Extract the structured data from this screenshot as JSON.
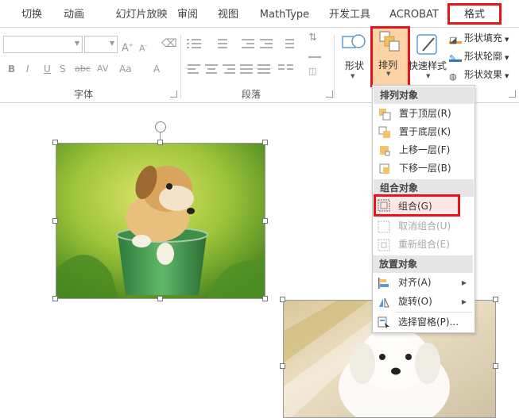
{
  "tabs": [
    {
      "label": "切换"
    },
    {
      "label": "动画"
    },
    {
      "label": "幻灯片放映"
    },
    {
      "label": "审阅"
    },
    {
      "label": "视图"
    },
    {
      "label": "MathType"
    },
    {
      "label": "开发工具"
    },
    {
      "label": "ACROBAT"
    },
    {
      "label": "格式",
      "active": true
    }
  ],
  "ribbon": {
    "font_group_label": "字体",
    "paragraph_group_label": "段落",
    "shape_label": "形状",
    "arrange_label": "排列",
    "quick_style_label": "快速样式",
    "shape_fill": "形状填充",
    "shape_outline": "形状轮廓",
    "shape_effects": "形状效果",
    "font_icons": {
      "bold": "B",
      "italic": "I",
      "underline": "U",
      "strike": "S",
      "abc": "abc",
      "av": "AV",
      "aa": "Aa",
      "a": "A"
    }
  },
  "menu": {
    "sections": [
      {
        "title": "排列对象",
        "items": [
          {
            "label": "置于顶层(R)",
            "icon": "bring-to-front-icon",
            "enabled": true
          },
          {
            "label": "置于底层(K)",
            "icon": "send-to-back-icon",
            "enabled": true
          },
          {
            "label": "上移一层(F)",
            "icon": "bring-forward-icon",
            "enabled": true
          },
          {
            "label": "下移一层(B)",
            "icon": "send-backward-icon",
            "enabled": true
          }
        ]
      },
      {
        "title": "组合对象",
        "items": [
          {
            "label": "组合(G)",
            "icon": "group-icon",
            "enabled": true,
            "highlighted": true
          },
          {
            "label": "取消组合(U)",
            "icon": "ungroup-icon",
            "enabled": false
          },
          {
            "label": "重新组合(E)",
            "icon": "regroup-icon",
            "enabled": false
          }
        ]
      },
      {
        "title": "放置对象",
        "items": [
          {
            "label": "对齐(A)",
            "icon": "align-icon",
            "enabled": true,
            "submenu": true
          },
          {
            "label": "旋转(O)",
            "icon": "rotate-icon",
            "enabled": true,
            "submenu": true
          },
          {
            "label": "选择窗格(P)...",
            "icon": "selection-pane-icon",
            "enabled": true
          }
        ]
      }
    ]
  },
  "colors": {
    "highlight_border": "#e8141c",
    "arrange_active_bg": "#fbd3a5"
  }
}
